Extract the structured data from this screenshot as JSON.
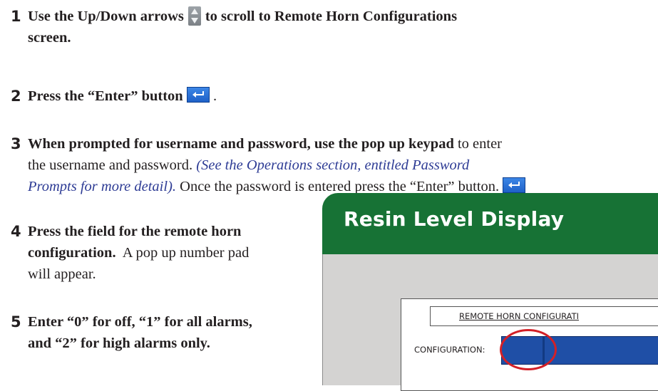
{
  "steps": [
    {
      "num": "1",
      "text_a": "Use the Up/Down arrows",
      "text_b": "to scroll to Remote Horn Configurations",
      "text_c": "screen."
    },
    {
      "num": "2",
      "text_a": "Press the “Enter” button",
      "text_b": "."
    },
    {
      "num": "3",
      "bold": "When prompted for username and password, use the pop up keypad",
      "plain": " to enter",
      "line2_plain": "the username and password. ",
      "ref_a": "(See the Operations section, entitled Password",
      "ref_b": "Prompts for more detail).",
      "line3_plain": " Once the password is entered press the “Enter” button."
    },
    {
      "num": "4",
      "bold_a": "Press the field for the remote horn",
      "bold_b": "configuration.",
      "plain_b": "  A pop up number pad",
      "plain_c": "will appear."
    },
    {
      "num": "5",
      "bold_a": "Enter “0” for off, “1” for all alarms,",
      "bold_b": "and “2” for high alarms only."
    }
  ],
  "icons": {
    "arrows": "up-down-arrows-icon",
    "enter": "enter-arrow-icon"
  },
  "panel": {
    "title": "Resin Level Display",
    "screen_title": "REMOTE HORN CONFIGURATI",
    "config_label": "CONFIGURATION:"
  },
  "colors": {
    "panel_header": "#177235",
    "link_blue": "#2e3c95",
    "field_blue": "#1f4fa6",
    "highlight_red": "#d32027"
  }
}
